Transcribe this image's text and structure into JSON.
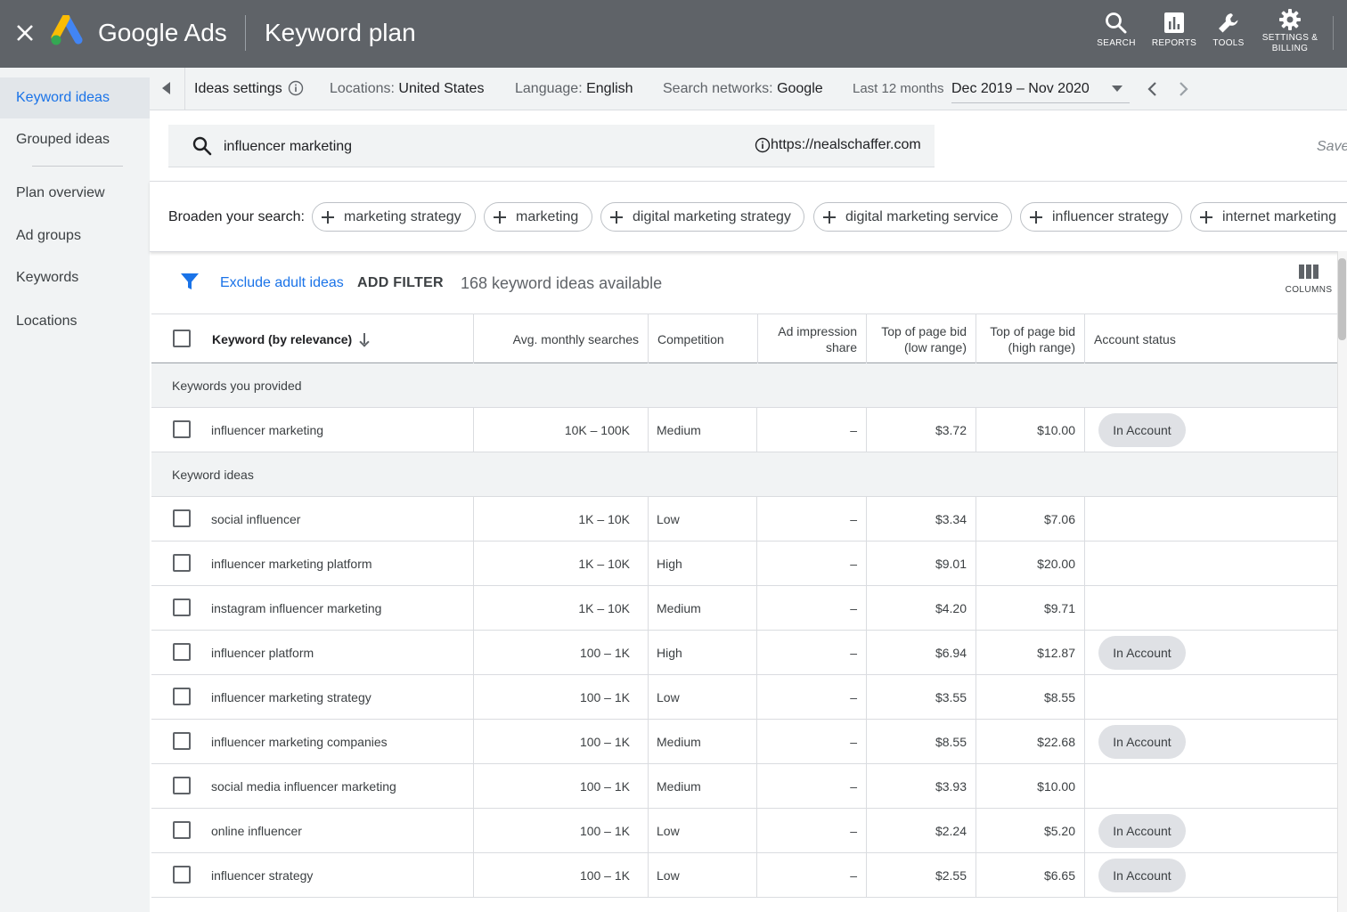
{
  "topbar": {
    "brand": "Google Ads",
    "title": "Keyword plan",
    "tools": [
      {
        "label": "SEARCH",
        "icon": "search-icon"
      },
      {
        "label": "REPORTS",
        "icon": "reports-icon"
      },
      {
        "label": "TOOLS",
        "icon": "wrench-icon"
      },
      {
        "label": "SETTINGS & BILLING",
        "icon": "gear-icon"
      }
    ]
  },
  "sidebar": {
    "items": [
      {
        "label": "Keyword ideas",
        "active": true
      },
      {
        "label": "Grouped ideas"
      },
      {
        "label": "Plan overview"
      },
      {
        "label": "Ad groups"
      },
      {
        "label": "Keywords"
      },
      {
        "label": "Locations"
      }
    ]
  },
  "settings": {
    "ideas_label": "Ideas settings",
    "locations_key": "Locations:",
    "locations_value": "United States",
    "language_key": "Language:",
    "language_value": "English",
    "networks_key": "Search networks:",
    "networks_value": "Google",
    "period_label": "Last 12 months",
    "date_range": "Dec 2019 – Nov 2020"
  },
  "search": {
    "term": "influencer marketing",
    "site": "https://nealschaffer.com",
    "save_label": "Save"
  },
  "broaden": {
    "label": "Broaden your search:",
    "chips": [
      "marketing strategy",
      "marketing",
      "digital marketing strategy",
      "digital marketing service",
      "influencer strategy",
      "internet marketing"
    ]
  },
  "filters": {
    "exclude_label": "Exclude adult ideas",
    "add_filter_label": "ADD FILTER",
    "ideas_count": "168 keyword ideas available",
    "columns_label": "COLUMNS"
  },
  "table": {
    "headers": {
      "keyword": "Keyword (by relevance)",
      "avg_searches": "Avg. monthly searches",
      "competition": "Competition",
      "impression_line1": "Ad impression",
      "impression_line2": "share",
      "low_bid_line1": "Top of page bid",
      "low_bid_line2": "(low range)",
      "high_bid_line1": "Top of page bid",
      "high_bid_line2": "(high range)",
      "status": "Account status"
    },
    "sections": [
      {
        "title": "Keywords you provided",
        "rows": [
          {
            "keyword": "influencer marketing",
            "searches": "10K – 100K",
            "competition": "Medium",
            "impression": "–",
            "low": "$3.72",
            "high": "$10.00",
            "status": "In Account"
          }
        ]
      },
      {
        "title": "Keyword ideas",
        "rows": [
          {
            "keyword": "social influencer",
            "searches": "1K – 10K",
            "competition": "Low",
            "impression": "–",
            "low": "$3.34",
            "high": "$7.06",
            "status": ""
          },
          {
            "keyword": "influencer marketing platform",
            "searches": "1K – 10K",
            "competition": "High",
            "impression": "–",
            "low": "$9.01",
            "high": "$20.00",
            "status": ""
          },
          {
            "keyword": "instagram influencer marketing",
            "searches": "1K – 10K",
            "competition": "Medium",
            "impression": "–",
            "low": "$4.20",
            "high": "$9.71",
            "status": ""
          },
          {
            "keyword": "influencer platform",
            "searches": "100 – 1K",
            "competition": "High",
            "impression": "–",
            "low": "$6.94",
            "high": "$12.87",
            "status": "In Account"
          },
          {
            "keyword": "influencer marketing strategy",
            "searches": "100 – 1K",
            "competition": "Low",
            "impression": "–",
            "low": "$3.55",
            "high": "$8.55",
            "status": ""
          },
          {
            "keyword": "influencer marketing companies",
            "searches": "100 – 1K",
            "competition": "Medium",
            "impression": "–",
            "low": "$8.55",
            "high": "$22.68",
            "status": "In Account"
          },
          {
            "keyword": "social media influencer marketing",
            "searches": "100 – 1K",
            "competition": "Medium",
            "impression": "–",
            "low": "$3.93",
            "high": "$10.00",
            "status": ""
          },
          {
            "keyword": "online influencer",
            "searches": "100 – 1K",
            "competition": "Low",
            "impression": "–",
            "low": "$2.24",
            "high": "$5.20",
            "status": "In Account"
          },
          {
            "keyword": "influencer strategy",
            "searches": "100 – 1K",
            "competition": "Low",
            "impression": "–",
            "low": "$2.55",
            "high": "$6.65",
            "status": "In Account"
          }
        ]
      }
    ]
  },
  "colors": {
    "topbar": "#5f6368",
    "accent": "#1a73e8",
    "nav_bg": "#f1f3f4",
    "badge_bg": "#dfe1e5"
  }
}
